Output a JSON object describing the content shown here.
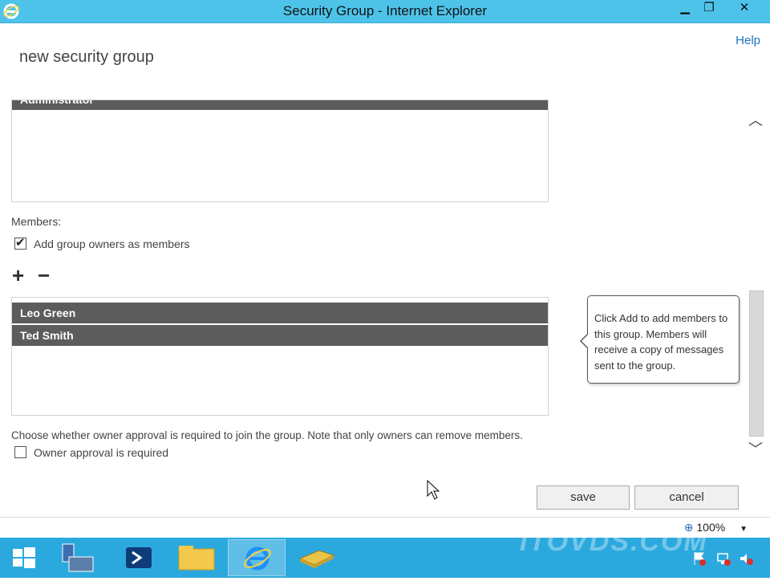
{
  "window": {
    "title": "Security Group - Internet Explorer",
    "minimize_glyph": "▁",
    "restore_glyph": "❐",
    "close_glyph": "✕",
    "icon": "internet-explorer-icon"
  },
  "header": {
    "help_label": "Help",
    "page_title": "new security group"
  },
  "owners": {
    "rows": [
      "Administrator"
    ]
  },
  "members": {
    "label": "Members:",
    "add_owners_checkbox_label": "Add group owners as members",
    "add_owners_checked": true,
    "add_glyph": "+",
    "remove_glyph": "−",
    "rows": [
      "Leo Green",
      "Ted Smith"
    ]
  },
  "tooltip": {
    "text": "Click Add to add members to this group. Members will receive a copy of messages sent to the group."
  },
  "approval": {
    "description": "Choose whether owner approval is required to join the group. Note that only owners can remove members.",
    "checkbox_label": "Owner approval is required",
    "checked": false
  },
  "actions": {
    "save_label": "save",
    "cancel_label": "cancel"
  },
  "scroll": {
    "up_glyph": "︿",
    "down_glyph": "﹀"
  },
  "statusbar": {
    "zoom": "100%",
    "zoom_icon": "zoom-icon",
    "dropdown_glyph": "▼"
  },
  "taskbar": {
    "items": [
      "start-icon",
      "server-manager-icon",
      "powershell-icon",
      "file-explorer-icon",
      "internet-explorer-icon",
      "exchange-icon"
    ],
    "watermark": "ITOVDS.COM"
  },
  "colors": {
    "titlebar": "#4ec3ea",
    "taskbar": "#2ba9de",
    "selected_row": "#5c5c5c",
    "link": "#1e72c8"
  }
}
